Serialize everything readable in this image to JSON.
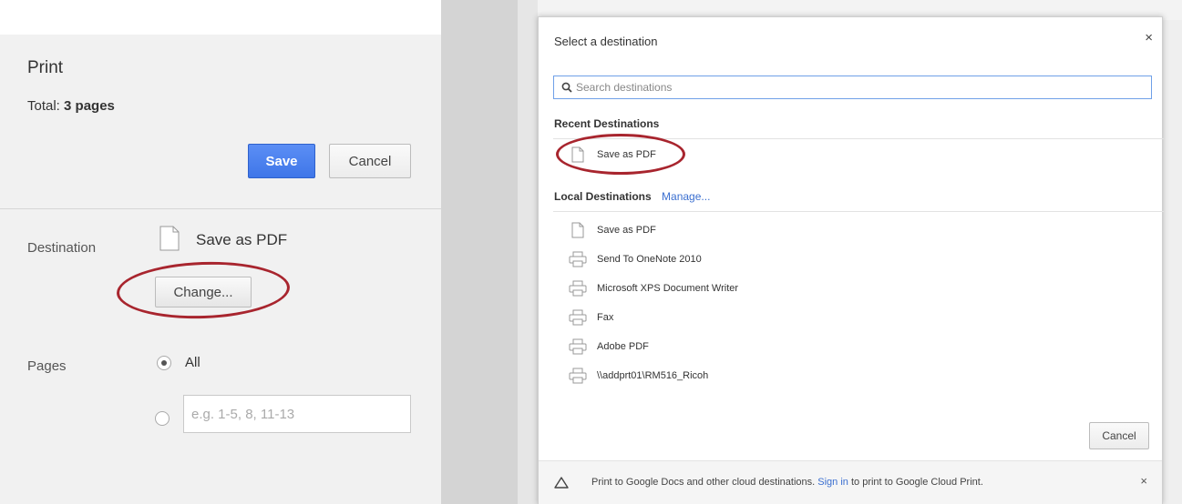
{
  "print_panel": {
    "title": "Print",
    "total_label": "Total:",
    "total_value": "3 pages",
    "save_label": "Save",
    "cancel_label": "Cancel",
    "destination_label": "Destination",
    "destination_value": "Save as PDF",
    "change_label": "Change...",
    "pages_label": "Pages",
    "pages_all_label": "All",
    "pages_custom_placeholder": "e.g. 1-5, 8, 11-13"
  },
  "dialog": {
    "title": "Select a destination",
    "close_glyph": "×",
    "search_placeholder": "Search destinations",
    "recent_title": "Recent Destinations",
    "recent_items": [
      {
        "label": "Save as PDF",
        "icon": "document-icon"
      }
    ],
    "local_title": "Local Destinations",
    "manage_label": "Manage...",
    "local_items": [
      {
        "label": "Save as PDF",
        "icon": "document-icon"
      },
      {
        "label": "Send To OneNote 2010",
        "icon": "printer-icon"
      },
      {
        "label": "Microsoft XPS Document Writer",
        "icon": "printer-icon"
      },
      {
        "label": "Fax",
        "icon": "printer-icon"
      },
      {
        "label": "Adobe PDF",
        "icon": "printer-icon"
      },
      {
        "label": "\\\\addprt01\\RM516_Ricoh",
        "icon": "printer-icon"
      }
    ],
    "cancel_label": "Cancel",
    "footer": {
      "text_before": "Print to Google Docs and other cloud destinations.",
      "link": "Sign in",
      "text_after": "to print to Google Cloud Print.",
      "close_glyph": "×"
    }
  },
  "colors": {
    "accent_blue": "#3f76e8",
    "annotation_red": "#a8252e",
    "link_blue": "#3b6fd0"
  }
}
